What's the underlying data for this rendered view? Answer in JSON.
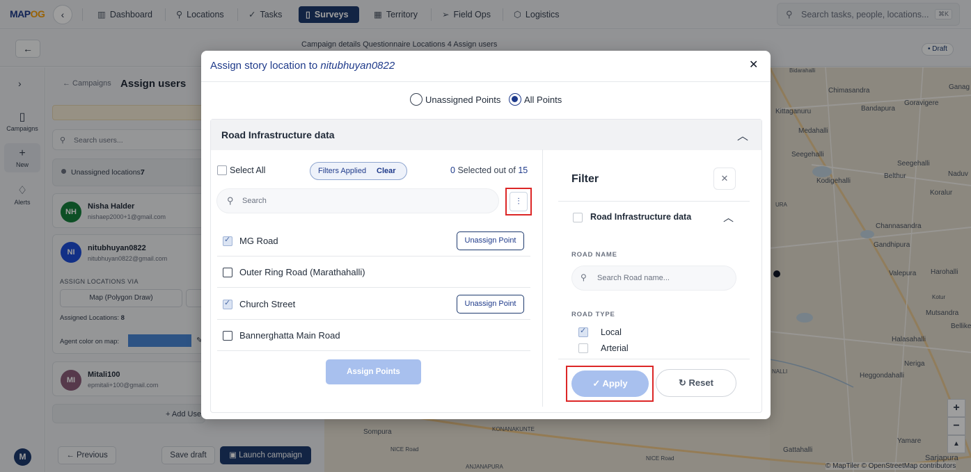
{
  "nav": {
    "logo_a": "MAP",
    "logo_b": "OG",
    "back_glyph": "‹",
    "items": [
      {
        "label": "Dashboard",
        "icon": "bar-chart-icon"
      },
      {
        "label": "Locations",
        "icon": "pin-icon"
      },
      {
        "label": "Tasks",
        "icon": "check-icon"
      },
      {
        "label": "Surveys",
        "icon": "clipboard-icon",
        "active": true
      },
      {
        "label": "Territory",
        "icon": "map-icon"
      },
      {
        "label": "Field Ops",
        "icon": "send-icon"
      },
      {
        "label": "Logistics",
        "icon": "box-icon"
      }
    ],
    "search_placeholder": "Search tasks, people, locations...",
    "search_kbd": "⌘K"
  },
  "subbar": {
    "steps": [
      "Campaign details",
      "Questionnaire",
      "Locations",
      "Assign users"
    ],
    "active_step_number": "4",
    "draft_badge": "• Draft"
  },
  "rail": {
    "items": [
      {
        "label": "Campaigns",
        "icon": "clipboard-icon"
      },
      {
        "label": "New",
        "icon": "plus-icon"
      },
      {
        "label": "Alerts",
        "icon": "bell-icon"
      }
    ],
    "avatar": "M"
  },
  "left_panel": {
    "breadcrumb": "← Campaigns",
    "title": "Assign users",
    "search_placeholder": "Search users...",
    "unassigned_label": "Unassigned locations:",
    "unassigned_count": "7",
    "users": [
      {
        "initials": "NH",
        "name": "Nisha Halder",
        "email": "nishaep2000+1@gmail.com",
        "color": "#15803d"
      },
      {
        "initials": "NI",
        "name": "nitubhuyan0822",
        "email": "nitubhuyan0822@gmail.com",
        "color": "#1d4ed8"
      },
      {
        "initials": "MI",
        "name": "Mitali100",
        "email": "epmitali+100@gmail.com",
        "color": "#8b5c7a"
      }
    ],
    "assign_via_label": "ASSIGN LOCATIONS VIA",
    "map_polygon_label": "Map (Polygon Draw)",
    "assigned_label": "Assigned Locations:",
    "assigned_count": "8",
    "agent_color_label": "Agent color on map:",
    "agent_color": "#4a86d6",
    "add_user_label": "+ Add Use",
    "previous": "← Previous",
    "save_draft": "Save draft",
    "launch": "Launch campaign"
  },
  "map": {
    "labels": [
      "Chimasandra",
      "Ganag",
      "Kittaganuru",
      "Bandapura",
      "Goravigere",
      "Medahalli",
      "Seegehalli",
      "Seegehalli",
      "Kodigehalli",
      "Belthur",
      "Naduv",
      "Koralur",
      "Channasandra",
      "Gandhipura",
      "Valepura",
      "Harohalli",
      "Kotur",
      "Mutsandra",
      "Bellike",
      "Halasahalli",
      "Neriga",
      "Heggondahalli",
      "Yamare",
      "Gattahalli",
      "Sarjapura",
      "Sompura",
      "KONANAKUNTE",
      "ANJANAPURA",
      "NICE Road",
      "NICE Road",
      "URA",
      "NALLI",
      "Bidarahalli"
    ],
    "attribution": "© MapTiler © OpenStreetMap contributors",
    "zoom_in": "+",
    "zoom_out": "−",
    "compass": "▲"
  },
  "modal": {
    "title_prefix": "Assign story location to",
    "title_user": "nitubhuyan0822",
    "close_glyph": "✕",
    "radio_unassigned": "Unassigned Points",
    "radio_all": "All Points",
    "accordion_title": "Road Infrastructure data",
    "select_all": "Select All",
    "filters_applied": "Filters Applied",
    "clear": "Clear",
    "selected_count": "0",
    "selected_text": "Selected out of",
    "total_count": "15",
    "search_placeholder": "Search",
    "rows": [
      {
        "label": "MG Road",
        "checked": true,
        "unassign": "Unassign Point"
      },
      {
        "label": "Outer Ring Road (Marathahalli)",
        "checked": false
      },
      {
        "label": "Church Street",
        "checked": true,
        "unassign": "Unassign Point"
      },
      {
        "label": "Bannerghatta Main Road",
        "checked": false
      }
    ],
    "assign_points": "Assign Points",
    "filter": {
      "title": "Filter",
      "section_label": "Road Infrastructure data",
      "road_name_label": "ROAD NAME",
      "road_name_placeholder": "Search Road name...",
      "road_type_label": "ROAD TYPE",
      "types": [
        {
          "label": "Local",
          "checked": true
        },
        {
          "label": "Arterial",
          "checked": false
        }
      ],
      "apply": "✓ Apply",
      "reset": "↻ Reset"
    }
  }
}
